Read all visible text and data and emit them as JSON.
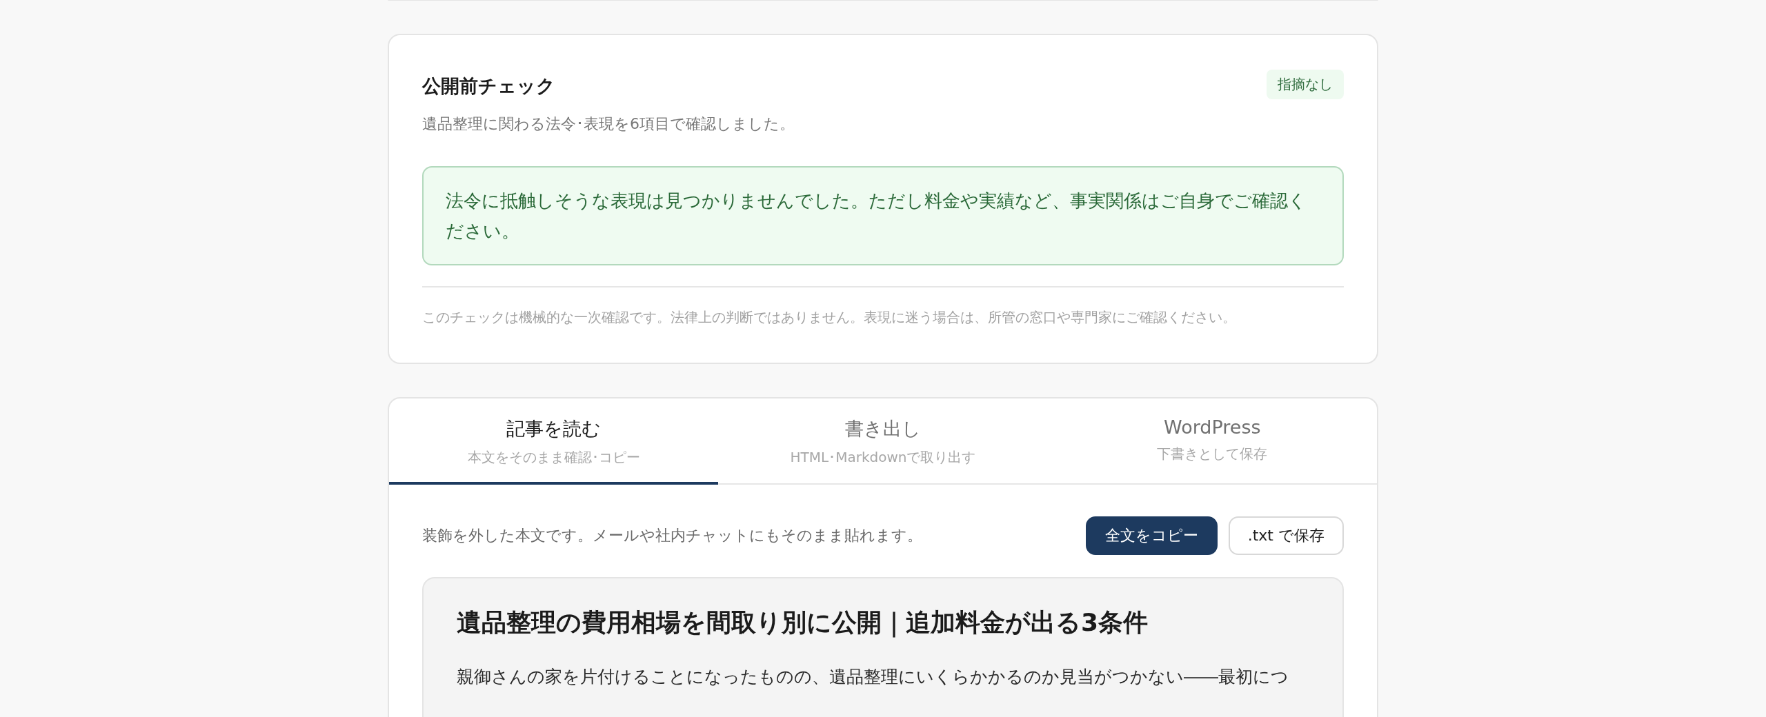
{
  "check_card": {
    "title": "公開前チェック",
    "subtitle": "遺品整理に関わる法令･表現を6項目で確認しました。",
    "badge": "指摘なし",
    "has_issues": false,
    "alert": "法令に抵触しそうな表現は見つかりませんでした。ただし料金や実績など、事実関係はご自身でご確認ください。",
    "footnote": "このチェックは機械的な一次確認です。法律上の判断ではありません。表現に迷う場合は、所管の窓口や専門家にご確認ください。"
  },
  "tabs": [
    {
      "label": "記事を読む",
      "sublabel": "本文をそのまま確認･コピー",
      "selected": true
    },
    {
      "label": "書き出し",
      "sublabel": "HTML･Markdownで取り出す",
      "selected": false
    },
    {
      "label": "WordPress",
      "sublabel": "下書きとして保存",
      "selected": false
    }
  ],
  "read_panel": {
    "description": "装飾を外した本文です。メールや社内チャットにもそのまま貼れます。",
    "buttons": [
      {
        "label": "全文をコピー",
        "kind": "primary"
      },
      {
        "label": ".txt で保存",
        "kind": "secondary"
      }
    ],
    "article": {
      "title": "遺品整理の費用相場を間取り別に公開｜追加料金が出る3条件",
      "body": "親御さんの家を片付けることになったものの、遺品整理にいくらかかるのか見当がつかない――最初につ"
    }
  }
}
